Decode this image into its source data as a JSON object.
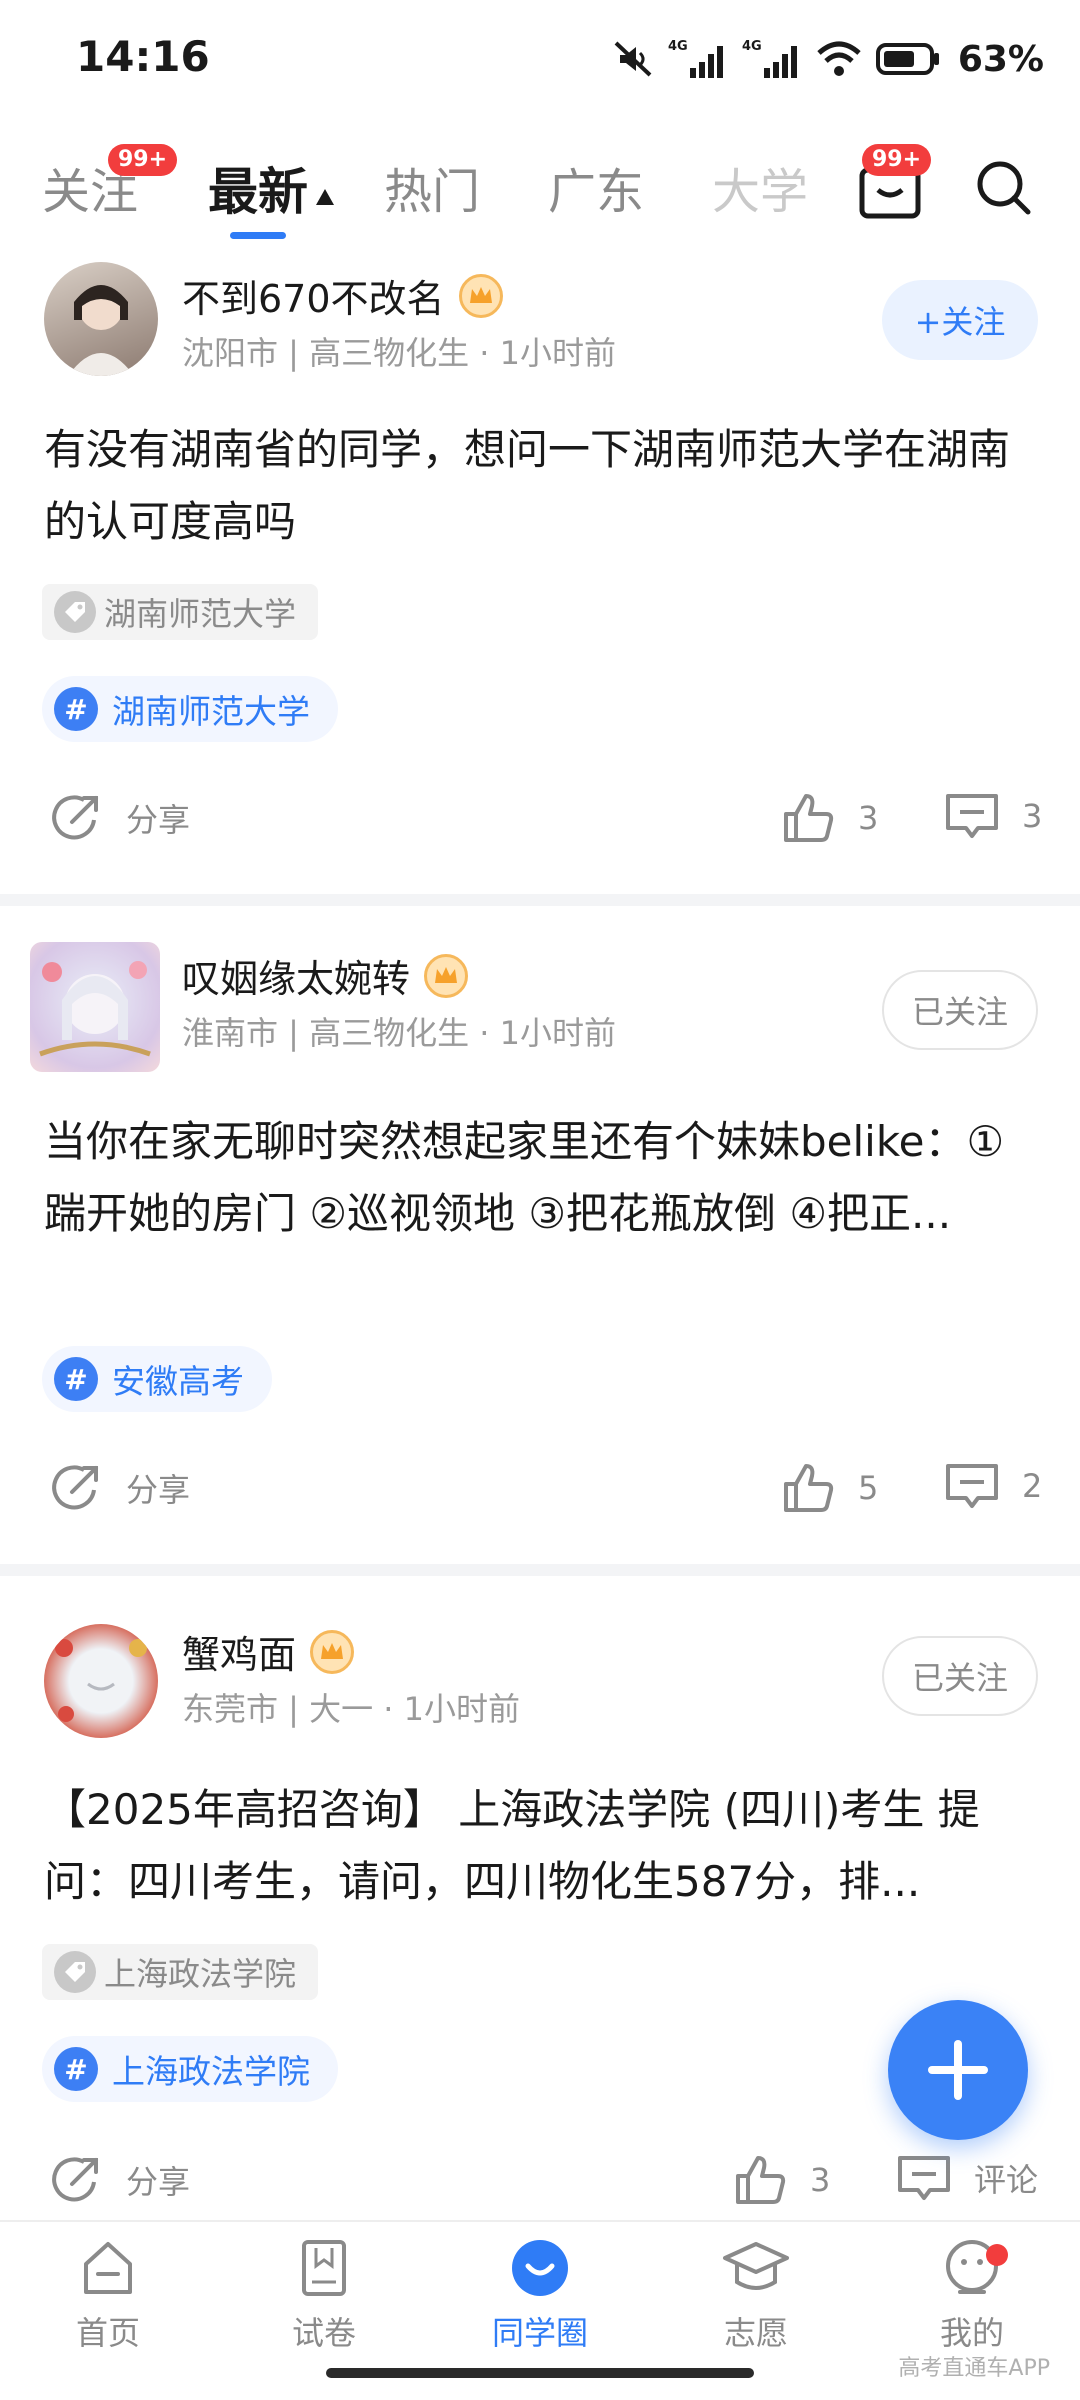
{
  "status_bar": {
    "time": "14:16",
    "battery": "63%",
    "network_label": "4G"
  },
  "top_tabs": [
    {
      "label": "关注",
      "badge": "99+"
    },
    {
      "label": "最新"
    },
    {
      "label": "热门"
    },
    {
      "label": "广东"
    },
    {
      "label": "大学"
    }
  ],
  "mail_badge": "99+",
  "posts": [
    {
      "username": "不到670不改名",
      "meta": "沈阳市 | 高三物化生 · 1小时前",
      "follow": "+关注",
      "text": "有没有湖南省的同学，想问一下湖南师范大学在湖南的认可度高吗",
      "tag": "湖南师范大学",
      "topic": "湖南师范大学",
      "share": "分享",
      "likes": "3",
      "comments": "3"
    },
    {
      "username": "叹姻缘太婉转",
      "meta": "淮南市 | 高三物化生 · 1小时前",
      "follow": "已关注",
      "text": "当你在家无聊时突然想起家里还有个妹妹belike：①踹开她的房门 ②巡视领地 ③把花瓶放倒 ④把正...",
      "topic": "安徽高考",
      "share": "分享",
      "likes": "5",
      "comments": "2"
    },
    {
      "username": "蟹鸡面",
      "meta": "东莞市 | 大一 · 1小时前",
      "follow": "已关注",
      "text": "【2025年高招咨询】 上海政法学院 (四川)考生 提问：四川考生，请问，四川物化生587分，排...",
      "tag": "上海政法学院",
      "topic": "上海政法学院",
      "share": "分享",
      "likes": "3",
      "comments": "评论"
    }
  ],
  "bottom_nav": [
    {
      "label": "首页",
      "icon": "home-icon"
    },
    {
      "label": "试卷",
      "icon": "paper-icon"
    },
    {
      "label": "同学圈",
      "icon": "circle-icon"
    },
    {
      "label": "志愿",
      "icon": "graduation-cap-icon"
    },
    {
      "label": "我的",
      "icon": "profile-icon"
    }
  ],
  "watermark": "高考直通车APP",
  "colors": {
    "accent": "#2f7cf6",
    "badge": "#f23d3d",
    "crown": "#f6b85b"
  }
}
